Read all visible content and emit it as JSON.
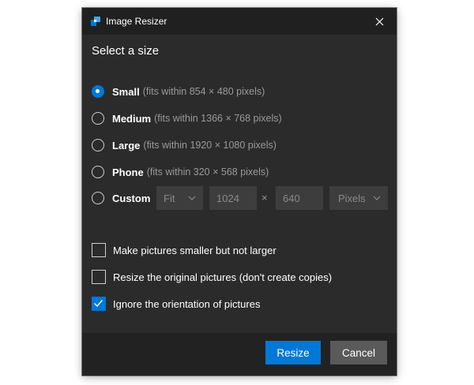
{
  "window": {
    "title": "Image Resizer"
  },
  "heading": "Select a size",
  "sizes": [
    {
      "name": "Small",
      "desc": "(fits within 854 × 480 pixels)",
      "selected": true
    },
    {
      "name": "Medium",
      "desc": "(fits within 1366 × 768 pixels)",
      "selected": false
    },
    {
      "name": "Large",
      "desc": "(fits within 1920 × 1080 pixels)",
      "selected": false
    },
    {
      "name": "Phone",
      "desc": "(fits within 320 × 568 pixels)",
      "selected": false
    }
  ],
  "custom": {
    "label": "Custom",
    "mode": "Fit",
    "width": "1024",
    "times": "×",
    "height": "640",
    "unit": "Pixels"
  },
  "options": [
    {
      "label": "Make pictures smaller but not larger",
      "checked": false
    },
    {
      "label": "Resize the original pictures (don't create copies)",
      "checked": false
    },
    {
      "label": "Ignore the orientation of pictures",
      "checked": true
    }
  ],
  "buttons": {
    "resize": "Resize",
    "cancel": "Cancel"
  },
  "colors": {
    "accent": "#0078d7",
    "window_bg": "#2b2b2b",
    "titlebar_bg": "#202020",
    "footer_bg": "#222222"
  },
  "icons": {
    "app": "image-resizer-icon",
    "close": "close-icon",
    "chevron": "chevron-down-icon",
    "check": "checkmark-icon"
  }
}
